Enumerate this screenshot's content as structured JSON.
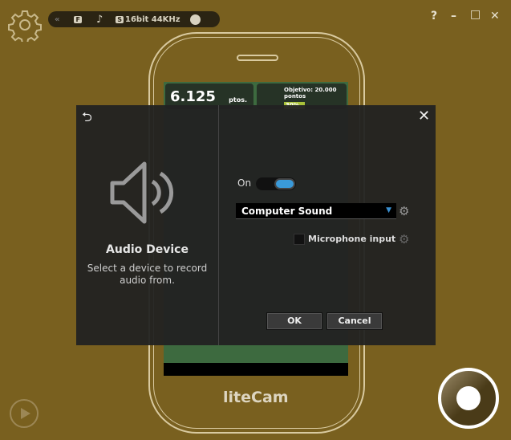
{
  "toolbar": {
    "collapse_icon": "double-chevron-left-icon",
    "audio_format": "16bit 44KHz",
    "s_badge": "S",
    "f_badge": "F"
  },
  "window": {
    "help": "?",
    "minimize": "–",
    "maximize": "□",
    "close": "✕"
  },
  "phone_screen": {
    "score": "6.125",
    "score_unit": "ptos.",
    "objective": "Objetivo: 20.000 pontos",
    "progress": "30%",
    "progress_value": 30
  },
  "logo": "liteCam",
  "dialog": {
    "title": "Audio Device",
    "description": "Select a device to record audio from.",
    "on_label": "On",
    "toggle_on": true,
    "device": "Computer Sound",
    "microphone_label": "Microphone input",
    "microphone_checked": false,
    "ok": "OK",
    "cancel": "Cancel",
    "accent": "#3a9ad9"
  }
}
